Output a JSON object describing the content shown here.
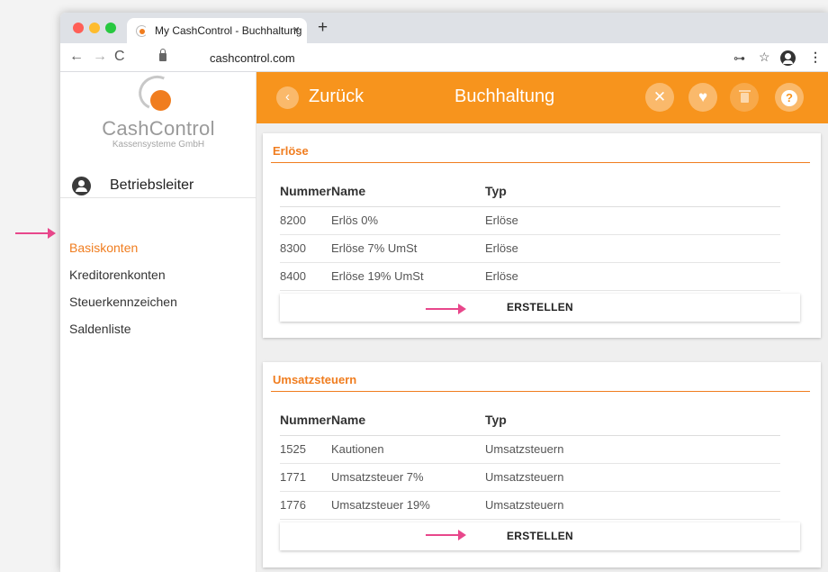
{
  "browser": {
    "tab_title": "My CashControl - Buchhaltung",
    "tab_close": "×",
    "new_tab": "+",
    "url": "cashcontrol.com",
    "back": "←",
    "forward": "→",
    "reload": "C",
    "key_icon": "⊶",
    "star_icon": "☆",
    "menu_icon": "⋮"
  },
  "sidebar": {
    "logo_name": "CashControl",
    "logo_sub": "Kassensysteme GmbH",
    "user": "Betriebsleiter",
    "items": [
      {
        "label": "Basiskonten",
        "active": true
      },
      {
        "label": "Kreditorenkonten",
        "active": false
      },
      {
        "label": "Steuerkennzeichen",
        "active": false
      },
      {
        "label": "Saldenliste",
        "active": false
      }
    ]
  },
  "topbar": {
    "back_label": "Zurück",
    "title": "Buchhaltung",
    "back_icon": "‹",
    "close_icon": "✕",
    "favorite_icon": "♥",
    "help_icon": "?"
  },
  "cards": [
    {
      "title": "Erlöse",
      "columns": [
        "Nummer",
        "Name",
        "Typ"
      ],
      "rows": [
        [
          "8200",
          "Erlös 0%",
          "Erlöse"
        ],
        [
          "8300",
          "Erlöse 7% UmSt",
          "Erlöse"
        ],
        [
          "8400",
          "Erlöse 19% UmSt",
          "Erlöse"
        ]
      ],
      "button": "ERSTELLEN"
    },
    {
      "title": "Umsatzsteuern",
      "columns": [
        "Nummer",
        "Name",
        "Typ"
      ],
      "rows": [
        [
          "1525",
          "Kautionen",
          "Umsatzsteuern"
        ],
        [
          "1771",
          "Umsatzsteuer 7%",
          "Umsatzsteuern"
        ],
        [
          "1776",
          "Umsatzsteuer 19%",
          "Umsatzsteuern"
        ]
      ],
      "button": "ERSTELLEN"
    }
  ],
  "colors": {
    "accent": "#f7941d",
    "accent_text": "#f07d1f",
    "annotation_arrow": "#e8478b"
  }
}
